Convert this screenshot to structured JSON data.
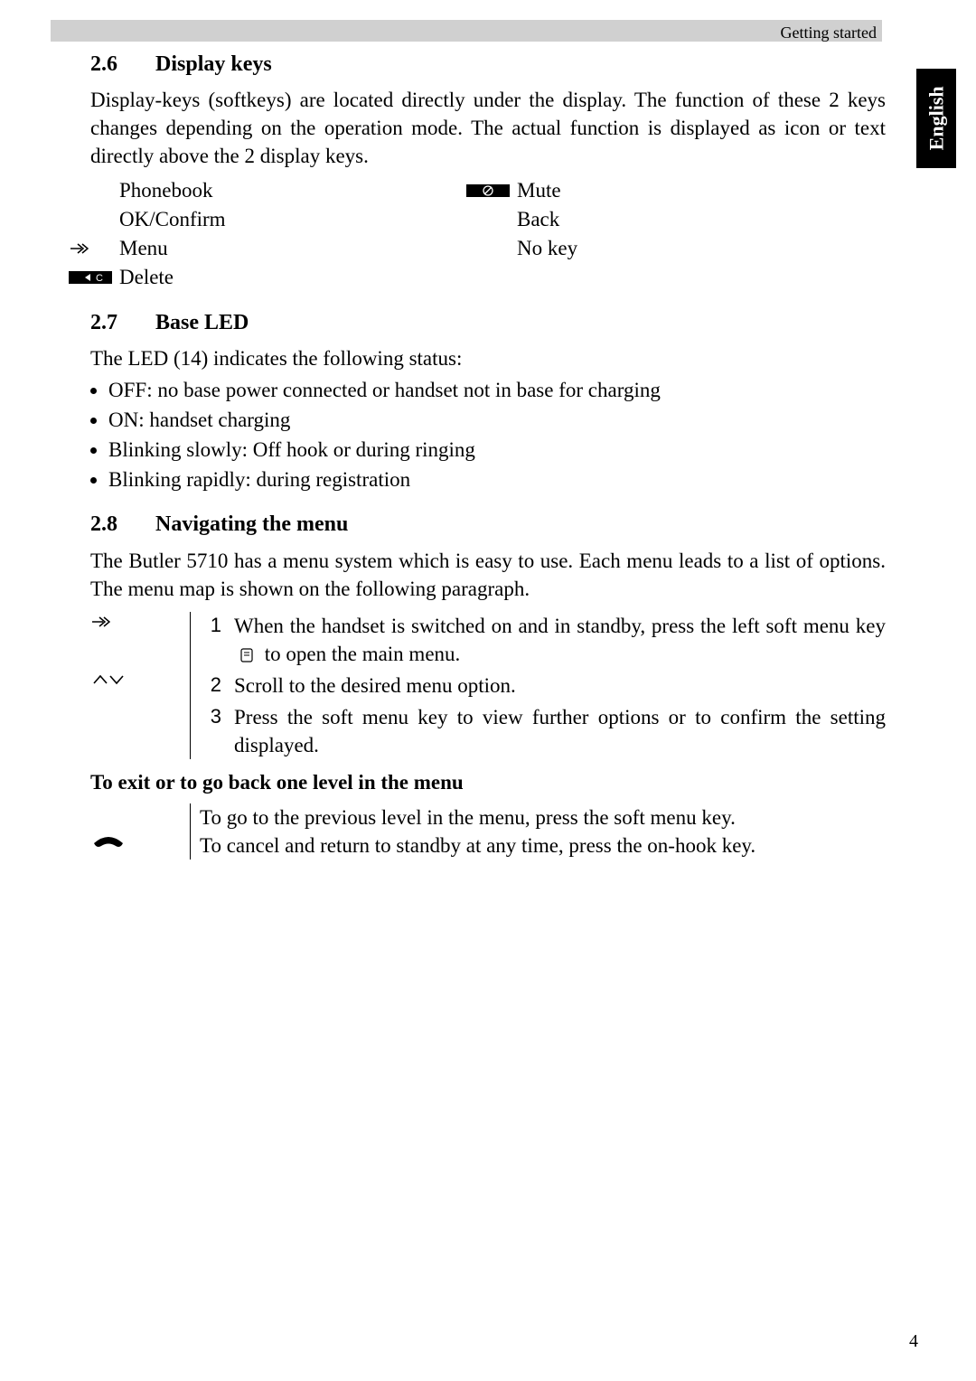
{
  "header": {
    "chapter": "Getting started",
    "lang_tab": "English"
  },
  "s26": {
    "num": "2.6",
    "title": "Display keys",
    "para": "Display-keys (softkeys) are located directly under the display. The function of these 2 keys changes depending on the operation mode. The actual function is displayed as icon or text directly above the 2 display keys.",
    "left": [
      "Phonebook",
      "OK/Confirm",
      "Menu",
      "Delete"
    ],
    "right": [
      "Mute",
      "Back",
      "No key"
    ]
  },
  "s27": {
    "num": "2.7",
    "title": "Base LED",
    "intro": "The LED (14) indicates the following status:",
    "items": [
      "OFF: no base power connected or handset not in base for charging",
      "ON: handset charging",
      "Blinking slowly: Off hook or during ringing",
      "Blinking rapidly: during registration"
    ]
  },
  "s28": {
    "num": "2.8",
    "title": "Navigating the menu",
    "para": "The Butler 5710 has a menu system which is easy to use. Each menu leads to a list of options. The menu map is shown on the following paragraph.",
    "steps": [
      {
        "n": "1",
        "pre": "When the handset is switched on and in standby, press the left soft menu key",
        "post": "to open the main menu."
      },
      {
        "n": "2",
        "text": "Scroll to the desired menu option."
      },
      {
        "n": "3",
        "text": "Press the soft menu key to view further options or to confirm the setting displayed."
      }
    ],
    "exit_title": "To exit or to go back one level in the menu",
    "exit1": "To go to the previous level in the menu, press the soft menu key.",
    "exit2": "To cancel and return to standby at any time, press the on-hook key."
  },
  "page_num": "4"
}
